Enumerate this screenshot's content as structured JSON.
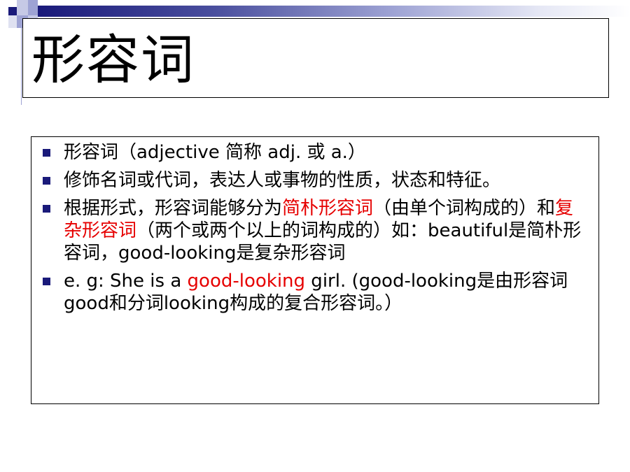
{
  "title": "形容词",
  "colors": {
    "accent": "#1a1a7a",
    "highlight": "#e60000"
  },
  "bullets": [
    {
      "parts": [
        "形容词（adjective 简称 adj. 或 a.）"
      ]
    },
    {
      "parts": [
        "修饰名词或代词，表达人或事物的性质，状态和特征。"
      ]
    },
    {
      "parts": [
        "根据形式，形容词能够分为",
        "简朴形容词",
        "（由单个词构成的）和",
        "复杂形容词",
        "（两个或两个以上的词构成的）如：beautiful是简朴形容词，good-looking是复杂形容词"
      ]
    },
    {
      "parts": [
        "e. g: She is a ",
        "good-looking",
        " girl. (good-looking是由形容词good和分词looking构成的复合形容词。）"
      ]
    }
  ]
}
